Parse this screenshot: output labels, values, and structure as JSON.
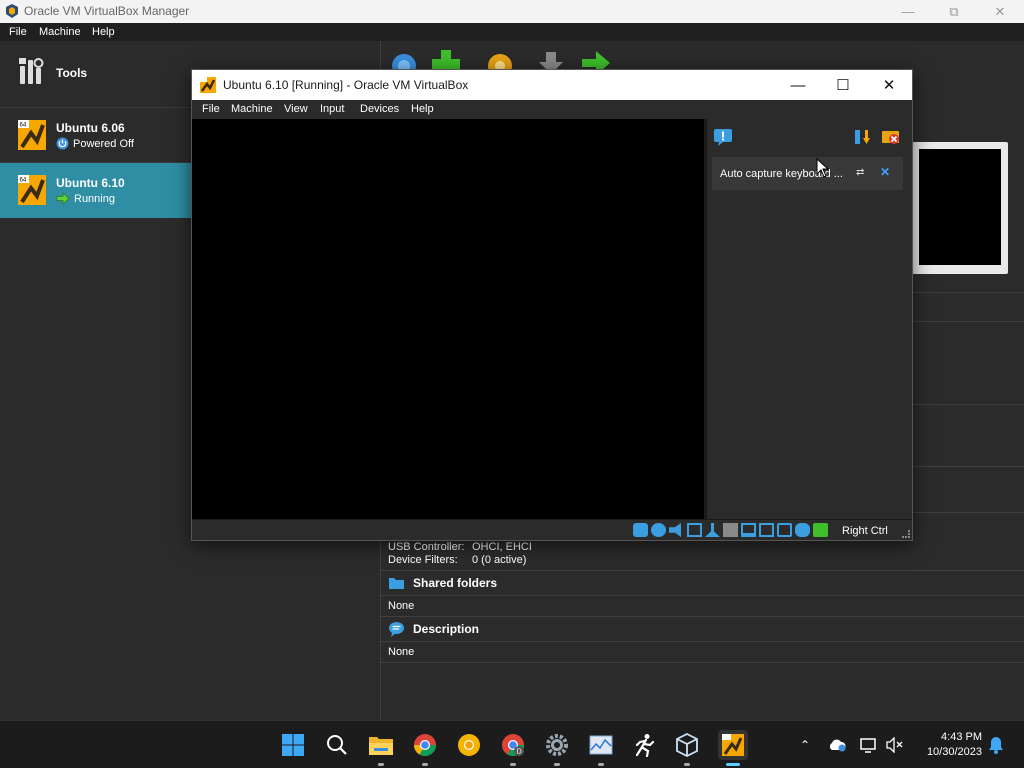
{
  "manager": {
    "title": "Oracle VM VirtualBox Manager",
    "menu": [
      "File",
      "Machine",
      "Help"
    ],
    "tools_label": "Tools",
    "vms": [
      {
        "name": "Ubuntu 6.06",
        "state": "Powered Off",
        "state_icon": "power-icon"
      },
      {
        "name": "Ubuntu 6.10",
        "state": "Running",
        "state_icon": "arrow-right-icon",
        "selected": true
      }
    ],
    "details": {
      "usb_controller_label": "USB Controller:",
      "usb_controller_value": "OHCI, EHCI",
      "device_filters_label": "Device Filters:",
      "device_filters_value": "0 (0 active)",
      "shared_folders_title": "Shared folders",
      "shared_folders_value": "None",
      "description_title": "Description",
      "description_value": "None"
    }
  },
  "vm_window": {
    "title": "Ubuntu 6.10 [Running] - Oracle VM VirtualBox",
    "menu": [
      "File",
      "Machine",
      "View",
      "Input",
      "Devices",
      "Help"
    ],
    "notification_text": "Auto capture keyboard ...",
    "host_key": "Right Ctrl"
  },
  "taskbar": {
    "time": "4:43 PM",
    "date": "10/30/2023"
  },
  "colors": {
    "selected_vm": "#2f8ea3",
    "accent_blue": "#60cdff",
    "window_bg": "#2b2b2b"
  }
}
